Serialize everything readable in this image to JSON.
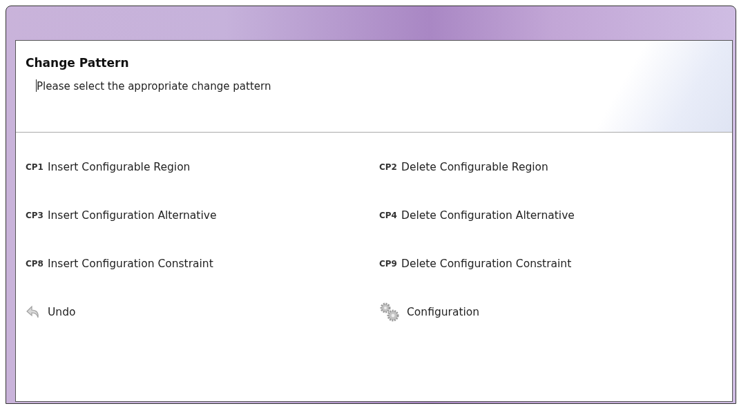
{
  "header": {
    "title": "Change Pattern",
    "description": "Please select the appropriate change pattern"
  },
  "actions": [
    {
      "kind": "pattern",
      "code": "CP1",
      "label": "Insert Configurable Region"
    },
    {
      "kind": "pattern",
      "code": "CP2",
      "label": "Delete Configurable Region"
    },
    {
      "kind": "pattern",
      "code": "CP3",
      "label": "Insert Configuration Alternative"
    },
    {
      "kind": "pattern",
      "code": "CP4",
      "label": "Delete Configuration Alternative"
    },
    {
      "kind": "pattern",
      "code": "CP8",
      "label": "Insert Configuration Constraint"
    },
    {
      "kind": "pattern",
      "code": "CP9",
      "label": "Delete Configuration Constraint"
    },
    {
      "kind": "undo",
      "label": "Undo"
    },
    {
      "kind": "settings",
      "label": "Configuration"
    }
  ]
}
